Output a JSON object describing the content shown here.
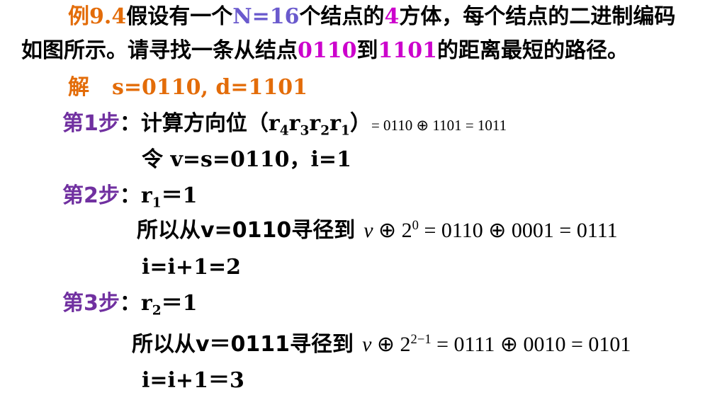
{
  "example": {
    "label": "例9.4",
    "text_a": "假设有一个",
    "n_value": "N=16",
    "text_b": "个结点的",
    "cube_dim": "4",
    "text_c": "方体，每个结点的二进制编码",
    "text_d": "如图所示。请寻找一条从结点",
    "from_node": "0110",
    "text_e": "到",
    "to_node": "1101",
    "text_f": "的距离最短的路径。"
  },
  "solution": {
    "label": "解",
    "given": "s=0110, d=1101"
  },
  "step1": {
    "label": "第1步",
    "colon": "：",
    "text": "计算方向位（",
    "r4": "r",
    "r4_sub": "4",
    "r3": "r",
    "r3_sub": "3",
    "r2": "r",
    "r2_sub": "2",
    "r1": "r",
    "r1_sub": "1",
    "close": "）",
    "equation": "= 0110 ⊕ 1101 = 1011",
    "line2": "令 v=s=0110，i=1"
  },
  "step2": {
    "label": "第2步",
    "colon": "：",
    "r": "r",
    "r_sub": "1",
    "r_rest": "＝1",
    "route_text": "所以从v=0110寻径到",
    "eq_v": "v",
    "eq_op": " ⊕ 2",
    "eq_exp": "0",
    "eq_rest": " = 0110 ⊕ 0001 = 0111",
    "increment": "i=i+1=2"
  },
  "step3": {
    "label": "第3步",
    "colon": "：",
    "r": "r",
    "r_sub": "2",
    "r_rest": "＝1",
    "route_text": "所以从v＝0111寻径到",
    "eq_v": "v",
    "eq_op": " ⊕ 2",
    "eq_exp": "2−1",
    "eq_rest": " = 0111 ⊕ 0010 = 0101",
    "increment": "i=i+1＝3"
  },
  "colors": {
    "orange": "#E36C09",
    "blue": "#6A5ACD",
    "magenta": "#CC00CC",
    "purple": "#7030A0"
  }
}
